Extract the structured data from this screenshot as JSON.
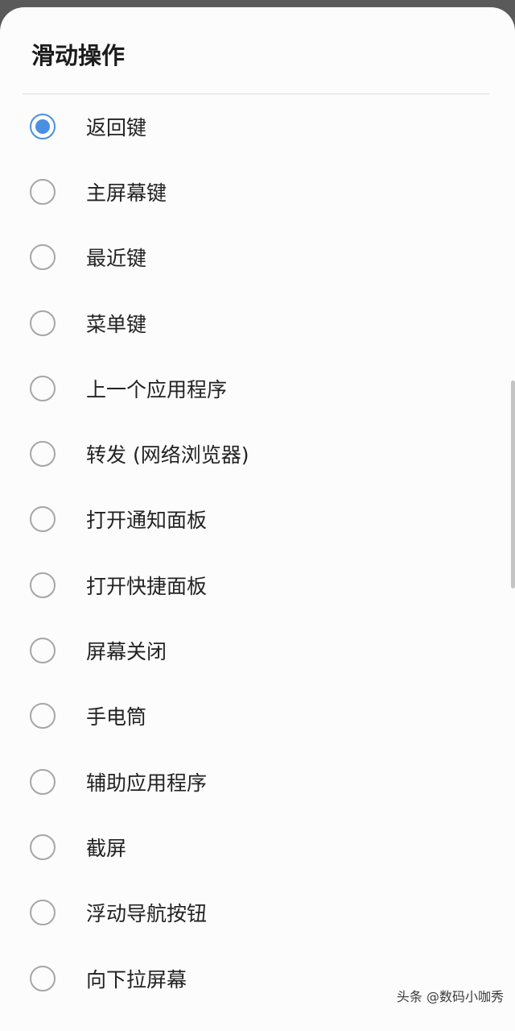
{
  "dialog": {
    "title": "滑动操作",
    "selected_index": 0,
    "options": [
      {
        "label": "返回键",
        "selected": true
      },
      {
        "label": "主屏幕键",
        "selected": false
      },
      {
        "label": "最近键",
        "selected": false
      },
      {
        "label": "菜单键",
        "selected": false
      },
      {
        "label": "上一个应用程序",
        "selected": false
      },
      {
        "label": "转发 (网络浏览器)",
        "selected": false
      },
      {
        "label": "打开通知面板",
        "selected": false
      },
      {
        "label": "打开快捷面板",
        "selected": false
      },
      {
        "label": "屏幕关闭",
        "selected": false
      },
      {
        "label": "手电筒",
        "selected": false
      },
      {
        "label": "辅助应用程序",
        "selected": false
      },
      {
        "label": "截屏",
        "selected": false
      },
      {
        "label": "浮动导航按钮",
        "selected": false
      },
      {
        "label": "向下拉屏幕",
        "selected": false
      }
    ]
  },
  "watermark": "头条 @数码小咖秀",
  "colors": {
    "accent": "#4a8fe2",
    "radio_border": "#a6a6a6",
    "background": "#fcfcfc"
  }
}
